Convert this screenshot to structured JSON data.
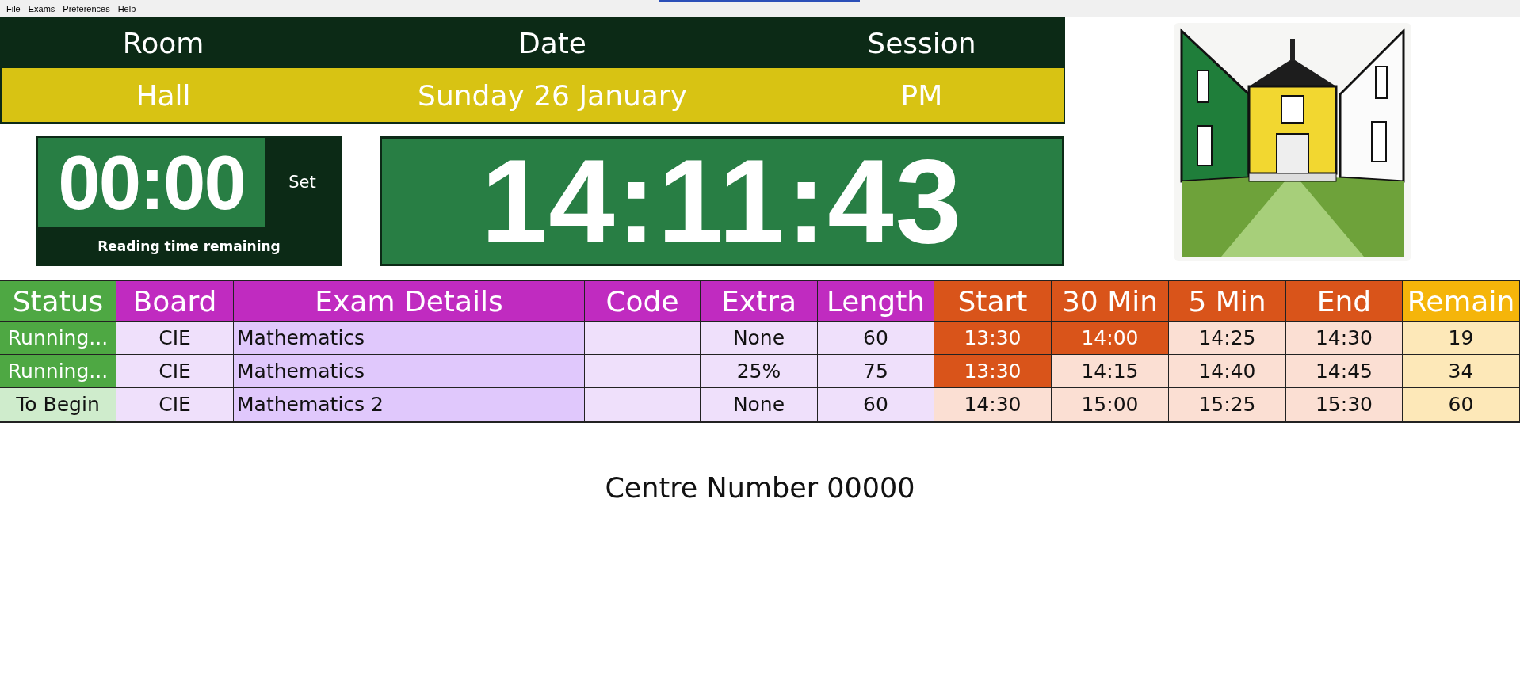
{
  "menu": [
    "File",
    "Exams",
    "Preferences",
    "Help"
  ],
  "header": [
    {
      "label": "Room",
      "value": "Hall"
    },
    {
      "label": "Date",
      "value": "Sunday 26 January"
    },
    {
      "label": "Session",
      "value": "PM"
    }
  ],
  "reading_timer": {
    "time": "00:00",
    "button": "Set",
    "caption": "Reading time remaining"
  },
  "clock": "14:11:43",
  "table": {
    "columns": [
      {
        "label": "Status",
        "kind": "status"
      },
      {
        "label": "Board",
        "kind": "details"
      },
      {
        "label": "Exam Details",
        "kind": "details"
      },
      {
        "label": "Code",
        "kind": "details"
      },
      {
        "label": "Extra",
        "kind": "details"
      },
      {
        "label": "Length",
        "kind": "details"
      },
      {
        "label": "Start",
        "kind": "times"
      },
      {
        "label": "30 Min",
        "kind": "times"
      },
      {
        "label": "5 Min",
        "kind": "times"
      },
      {
        "label": "End",
        "kind": "times"
      },
      {
        "label": "Remain",
        "kind": "remain"
      }
    ],
    "rows": [
      {
        "status": {
          "text": "Running...",
          "kind": "running"
        },
        "board": "CIE",
        "exam": "Mathematics",
        "extra": "None",
        "length": "60",
        "times": [
          {
            "text": "13:30",
            "passed": true
          },
          {
            "text": "14:00",
            "passed": true
          },
          {
            "text": "14:25",
            "passed": false
          },
          {
            "text": "14:30",
            "passed": false
          }
        ],
        "remain": "19"
      },
      {
        "status": {
          "text": "Running...",
          "kind": "running"
        },
        "board": "CIE",
        "exam": "Mathematics",
        "extra": "25%",
        "length": "75",
        "times": [
          {
            "text": "13:30",
            "passed": true
          },
          {
            "text": "14:15",
            "passed": false
          },
          {
            "text": "14:40",
            "passed": false
          },
          {
            "text": "14:45",
            "passed": false
          }
        ],
        "remain": "34"
      },
      {
        "status": {
          "text": "To Begin",
          "kind": "pending"
        },
        "board": "CIE",
        "exam": "Mathematics 2",
        "extra": "None",
        "length": "60",
        "times": [
          {
            "text": "14:30",
            "passed": false
          },
          {
            "text": "15:00",
            "passed": false
          },
          {
            "text": "15:25",
            "passed": false
          },
          {
            "text": "15:30",
            "passed": false
          }
        ],
        "remain": "60"
      }
    ]
  },
  "footer": "Centre Number 00000"
}
